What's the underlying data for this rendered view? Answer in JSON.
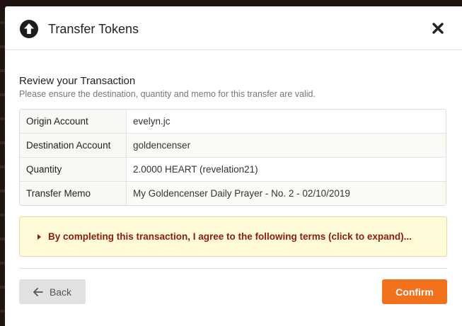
{
  "modal": {
    "title": "Transfer Tokens",
    "header_icon": "arrow-circle-up-icon",
    "close_icon": "close-icon"
  },
  "review": {
    "title": "Review your Transaction",
    "subtitle": "Please ensure the destination, quantity and memo for this transfer are valid."
  },
  "details": [
    {
      "label": "Origin Account",
      "value": "evelyn.jc"
    },
    {
      "label": "Destination Account",
      "value": "goldencenser"
    },
    {
      "label": "Quantity",
      "value": "2.0000 HEART (revelation21)"
    },
    {
      "label": "Transfer Memo",
      "value": "My Goldencenser Daily Prayer - No. 2 - 02/10/2019"
    }
  ],
  "terms": {
    "text": "By completing this transaction, I agree to the following terms (click to expand)...",
    "icon": "caret-right-icon"
  },
  "actions": {
    "back_label": "Back",
    "back_icon": "arrow-left-icon",
    "confirm_label": "Confirm"
  },
  "colors": {
    "confirm": "#f2711c",
    "terms_text": "#8b1d10",
    "terms_bg": "#fffad7"
  }
}
